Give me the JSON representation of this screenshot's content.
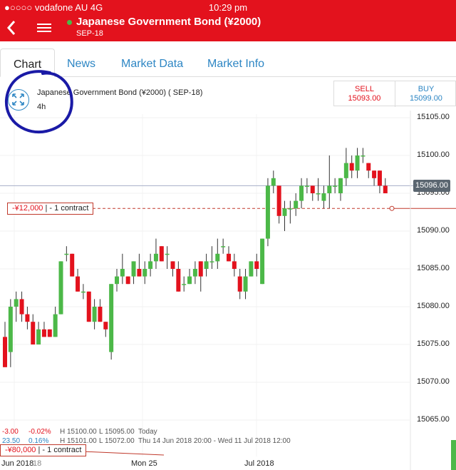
{
  "status_bar": {
    "carrier": "●○○○○ vodafone AU  4G",
    "time": "10:29 pm"
  },
  "nav": {
    "title": "Japanese Government Bond (¥2000)",
    "subtitle": "SEP-18"
  },
  "tabs": [
    {
      "label": "Chart",
      "active": true
    },
    {
      "label": "News",
      "active": false
    },
    {
      "label": "Market Data",
      "active": false
    },
    {
      "label": "Market Info",
      "active": false
    }
  ],
  "instrument": {
    "name": "Japanese Government Bond (¥2000) ( SEP-18)",
    "interval": "4h"
  },
  "quote": {
    "sell_label": "SELL",
    "sell_value": "15093.00",
    "buy_label": "BUY",
    "buy_value": "15099.00"
  },
  "current_price": "15096.00",
  "order": {
    "pl": "-¥12,000",
    "size": "- 1 contract"
  },
  "order2": {
    "pl": "-¥80,000",
    "size": "- 1 contract"
  },
  "stats": {
    "row1": {
      "change": "-3.00",
      "pct": "-0.02%",
      "high": "H 15100.00",
      "low": "L 15095.00",
      "period": "Today"
    },
    "row2": {
      "change": "23.50",
      "pct": "0.16%",
      "high": "H 15101.00",
      "low": "L 15072.00",
      "period": "Thu 14 Jun 2018 20:00 - Wed 11 Jul 2018 12:00"
    }
  },
  "x_labels": [
    "Jun 2018",
    "18",
    "Mon 25",
    "Jul 2018"
  ],
  "colors": {
    "brand_red": "#e3121d",
    "up": "#4cb848",
    "down": "#e3121d",
    "link_blue": "#2d86c4",
    "annotation": "#1a1aa6"
  },
  "chart_data": {
    "type": "candlestick",
    "y_ticks": [
      15105,
      15100,
      15095,
      15090,
      15085,
      15080,
      15075,
      15070,
      15065
    ],
    "ylim": [
      15061,
      15111
    ],
    "current_price": 15096,
    "order_level": 15093,
    "candles": [
      [
        15076,
        15078,
        15072,
        15072
      ],
      [
        15074,
        15081,
        15072,
        15080
      ],
      [
        15080,
        15082,
        15078,
        15081
      ],
      [
        15081,
        15082,
        15078,
        15079
      ],
      [
        15079,
        15080,
        15077,
        15078
      ],
      [
        15078,
        15079,
        15075,
        15075
      ],
      [
        15075,
        15078,
        15075,
        15077
      ],
      [
        15077,
        15078,
        15076,
        15076
      ],
      [
        15077,
        15077,
        15076,
        15076
      ],
      [
        15076,
        15080,
        15076,
        15079
      ],
      [
        15079,
        15086,
        15079,
        15086
      ],
      [
        15087,
        15088,
        15086,
        15087
      ],
      [
        15087,
        15087,
        15084,
        15084
      ],
      [
        15084,
        15085,
        15082,
        15082
      ],
      [
        15082,
        15083,
        15081,
        15082
      ],
      [
        15082,
        15082,
        15078,
        15078
      ],
      [
        15078,
        15081,
        15077,
        15080
      ],
      [
        15080,
        15081,
        15078,
        15078
      ],
      [
        15078,
        15078,
        15076,
        15077
      ],
      [
        15074,
        15083,
        15073,
        15083
      ],
      [
        15083,
        15085,
        15082,
        15084
      ],
      [
        15084,
        15087,
        15083,
        15085
      ],
      [
        15084,
        15084,
        15083,
        15083
      ],
      [
        15084,
        15086,
        15083,
        15086
      ],
      [
        15085,
        15087,
        15084,
        15084
      ],
      [
        15084,
        15086,
        15083,
        15085
      ],
      [
        15085,
        15087,
        15084,
        15086
      ],
      [
        15086,
        15089,
        15085,
        15087
      ],
      [
        15088,
        15088,
        15086,
        15086
      ],
      [
        15087,
        15088,
        15085,
        15087
      ],
      [
        15086,
        15086,
        15084,
        15085
      ],
      [
        15085,
        15086,
        15082,
        15082
      ],
      [
        15083,
        15084,
        15082,
        15083
      ],
      [
        15083,
        15085,
        15083,
        15084
      ],
      [
        15084,
        15086,
        15083,
        15085
      ],
      [
        15086,
        15086,
        15082,
        15084
      ],
      [
        15085,
        15087,
        15084,
        15086
      ],
      [
        15086,
        15088,
        15085,
        15086
      ],
      [
        15086,
        15089,
        15085,
        15087
      ],
      [
        15088,
        15089,
        15087,
        15088
      ],
      [
        15087,
        15088,
        15086,
        15086
      ],
      [
        15086,
        15087,
        15084,
        15085
      ],
      [
        15084,
        15085,
        15081,
        15082
      ],
      [
        15082,
        15085,
        15081,
        15084
      ],
      [
        15084,
        15086,
        15084,
        15086
      ],
      [
        15086,
        15087,
        15084,
        15085
      ],
      [
        15083,
        15089,
        15083,
        15089
      ],
      [
        15089,
        15097,
        15088,
        15096
      ],
      [
        15096,
        15098,
        15095,
        15097
      ],
      [
        15096,
        15096,
        15091,
        15092
      ],
      [
        15092,
        15094,
        15090,
        15093
      ],
      [
        15093,
        15094,
        15091,
        15093
      ],
      [
        15093,
        15095,
        15092,
        15094
      ],
      [
        15094,
        15097,
        15093,
        15096
      ],
      [
        15096,
        15097,
        15095,
        15096
      ],
      [
        15096,
        15096,
        15094,
        15095
      ],
      [
        15095,
        15097,
        15094,
        15095
      ],
      [
        15094,
        15096,
        15093,
        15095
      ],
      [
        15095,
        15100,
        15093,
        15096
      ],
      [
        15096,
        15097,
        15095,
        15096
      ],
      [
        15095,
        15097,
        15094,
        15097
      ],
      [
        15097,
        15101,
        15096,
        15099
      ],
      [
        15099,
        15100,
        15097,
        15098
      ],
      [
        15098,
        15101,
        15097,
        15100
      ],
      [
        15100,
        15101,
        15099,
        15100
      ],
      [
        15099,
        15099,
        15097,
        15098
      ],
      [
        15098,
        15098,
        15096,
        15097
      ],
      [
        15098,
        15098,
        15095,
        15096
      ],
      [
        15096,
        15097,
        15095,
        15095
      ]
    ]
  }
}
